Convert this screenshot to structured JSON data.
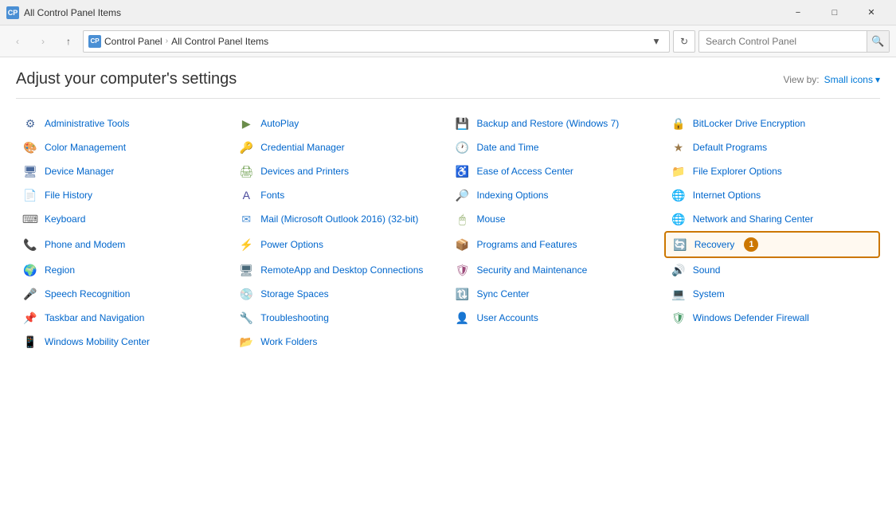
{
  "titlebar": {
    "title": "All Control Panel Items",
    "minimize": "−",
    "maximize": "□",
    "close": "✕"
  },
  "addressbar": {
    "back": "‹",
    "forward": "›",
    "up": "↑",
    "breadcrumbs": [
      "Control Panel",
      "All Control Panel Items"
    ],
    "dropdown": "▾",
    "refresh": "↻",
    "search_placeholder": "Search Control Panel",
    "search_icon": "🔍"
  },
  "header": {
    "title": "Adjust your computer's settings",
    "viewby_label": "View by:",
    "viewby_value": "Small icons",
    "viewby_chevron": "▾"
  },
  "items": [
    {
      "col": 0,
      "label": "Administrative Tools",
      "icon": "⚙",
      "iconClass": "icon-admin"
    },
    {
      "col": 1,
      "label": "AutoPlay",
      "icon": "▶",
      "iconClass": "icon-autoplay"
    },
    {
      "col": 2,
      "label": "Backup and Restore (Windows 7)",
      "icon": "💾",
      "iconClass": "icon-backup"
    },
    {
      "col": 3,
      "label": "BitLocker Drive Encryption",
      "icon": "🔒",
      "iconClass": "icon-bitlocker"
    },
    {
      "col": 0,
      "label": "Color Management",
      "icon": "🎨",
      "iconClass": "icon-color"
    },
    {
      "col": 1,
      "label": "Credential Manager",
      "icon": "🔑",
      "iconClass": "icon-credential"
    },
    {
      "col": 2,
      "label": "Date and Time",
      "icon": "🕐",
      "iconClass": "icon-datetime"
    },
    {
      "col": 3,
      "label": "Default Programs",
      "icon": "★",
      "iconClass": "icon-default"
    },
    {
      "col": 0,
      "label": "Device Manager",
      "icon": "🖥",
      "iconClass": "icon-device"
    },
    {
      "col": 1,
      "label": "Devices and Printers",
      "icon": "🖨",
      "iconClass": "icon-devices"
    },
    {
      "col": 2,
      "label": "Ease of Access Center",
      "icon": "♿",
      "iconClass": "icon-ease"
    },
    {
      "col": 3,
      "label": "File Explorer Options",
      "icon": "📁",
      "iconClass": "icon-fileexplorer"
    },
    {
      "col": 0,
      "label": "File History",
      "icon": "📄",
      "iconClass": "icon-filehistory"
    },
    {
      "col": 1,
      "label": "Fonts",
      "icon": "A",
      "iconClass": "icon-fonts"
    },
    {
      "col": 2,
      "label": "Indexing Options",
      "icon": "🔎",
      "iconClass": "icon-indexing"
    },
    {
      "col": 3,
      "label": "Internet Options",
      "icon": "🌐",
      "iconClass": "icon-internet"
    },
    {
      "col": 0,
      "label": "Keyboard",
      "icon": "⌨",
      "iconClass": "icon-keyboard"
    },
    {
      "col": 1,
      "label": "Mail (Microsoft Outlook 2016) (32-bit)",
      "icon": "✉",
      "iconClass": "icon-mail"
    },
    {
      "col": 2,
      "label": "Mouse",
      "icon": "🖱",
      "iconClass": "icon-mouse"
    },
    {
      "col": 3,
      "label": "Network and Sharing Center",
      "icon": "🌐",
      "iconClass": "icon-network"
    },
    {
      "col": 0,
      "label": "Phone and Modem",
      "icon": "📞",
      "iconClass": "icon-phone"
    },
    {
      "col": 1,
      "label": "Power Options",
      "icon": "⚡",
      "iconClass": "icon-power"
    },
    {
      "col": 2,
      "label": "Programs and Features",
      "icon": "📦",
      "iconClass": "icon-programs"
    },
    {
      "col": 3,
      "label": "Recovery",
      "icon": "🔄",
      "iconClass": "icon-recovery",
      "highlighted": true,
      "badge": "1"
    },
    {
      "col": 0,
      "label": "Region",
      "icon": "🌍",
      "iconClass": "icon-region"
    },
    {
      "col": 1,
      "label": "RemoteApp and Desktop Connections",
      "icon": "🖥",
      "iconClass": "icon-remoteapp"
    },
    {
      "col": 2,
      "label": "Security and Maintenance",
      "icon": "🛡",
      "iconClass": "icon-security"
    },
    {
      "col": 3,
      "label": "Sound",
      "icon": "🔊",
      "iconClass": "icon-sound"
    },
    {
      "col": 0,
      "label": "Speech Recognition",
      "icon": "🎤",
      "iconClass": "icon-speech"
    },
    {
      "col": 1,
      "label": "Storage Spaces",
      "icon": "💿",
      "iconClass": "icon-storage"
    },
    {
      "col": 2,
      "label": "Sync Center",
      "icon": "🔃",
      "iconClass": "icon-sync"
    },
    {
      "col": 3,
      "label": "System",
      "icon": "💻",
      "iconClass": "icon-system"
    },
    {
      "col": 0,
      "label": "Taskbar and Navigation",
      "icon": "📌",
      "iconClass": "icon-taskbar"
    },
    {
      "col": 1,
      "label": "Troubleshooting",
      "icon": "🔧",
      "iconClass": "icon-troubleshoot"
    },
    {
      "col": 2,
      "label": "User Accounts",
      "icon": "👤",
      "iconClass": "icon-user"
    },
    {
      "col": 3,
      "label": "Windows Defender Firewall",
      "icon": "🛡",
      "iconClass": "icon-windows-defender"
    },
    {
      "col": 0,
      "label": "Windows Mobility Center",
      "icon": "📱",
      "iconClass": "icon-mobility"
    },
    {
      "col": 1,
      "label": "Work Folders",
      "icon": "📂",
      "iconClass": "icon-workfolders"
    }
  ]
}
